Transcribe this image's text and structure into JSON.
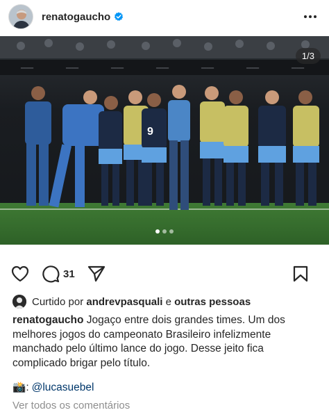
{
  "header": {
    "username": "renatogaucho",
    "verified_icon": "verified-badge-icon",
    "more_icon": "more-dots-icon"
  },
  "photo": {
    "counter": "1/3",
    "current_slide": 1,
    "total_slides": 3,
    "alt_icon": "photo"
  },
  "actions": {
    "like_icon": "heart-icon",
    "comment_icon": "comment-icon",
    "comment_count": "31",
    "share_icon": "send-icon",
    "save_icon": "bookmark-icon"
  },
  "likes": {
    "prefix": "Curtido por",
    "user": "andrevpasquali",
    "joiner": "e",
    "others": "outras pessoas"
  },
  "caption": {
    "username": "renatogaucho",
    "text": "Jogaço entre dois grandes times. Um dos melhores jogos do campeonato Brasileiro infelizmente manchado pelo último lance do jogo.  Desse jeito fica complicado brigar pelo título."
  },
  "credit": {
    "emoji": "📸",
    "separator": ":",
    "mention": "@lucasuebel"
  },
  "comments": {
    "view_all": "Ver todos os comentários"
  },
  "colors": {
    "text": "#262626",
    "muted": "#8e8e8e",
    "link": "#00376b",
    "verified": "#0095f6"
  }
}
